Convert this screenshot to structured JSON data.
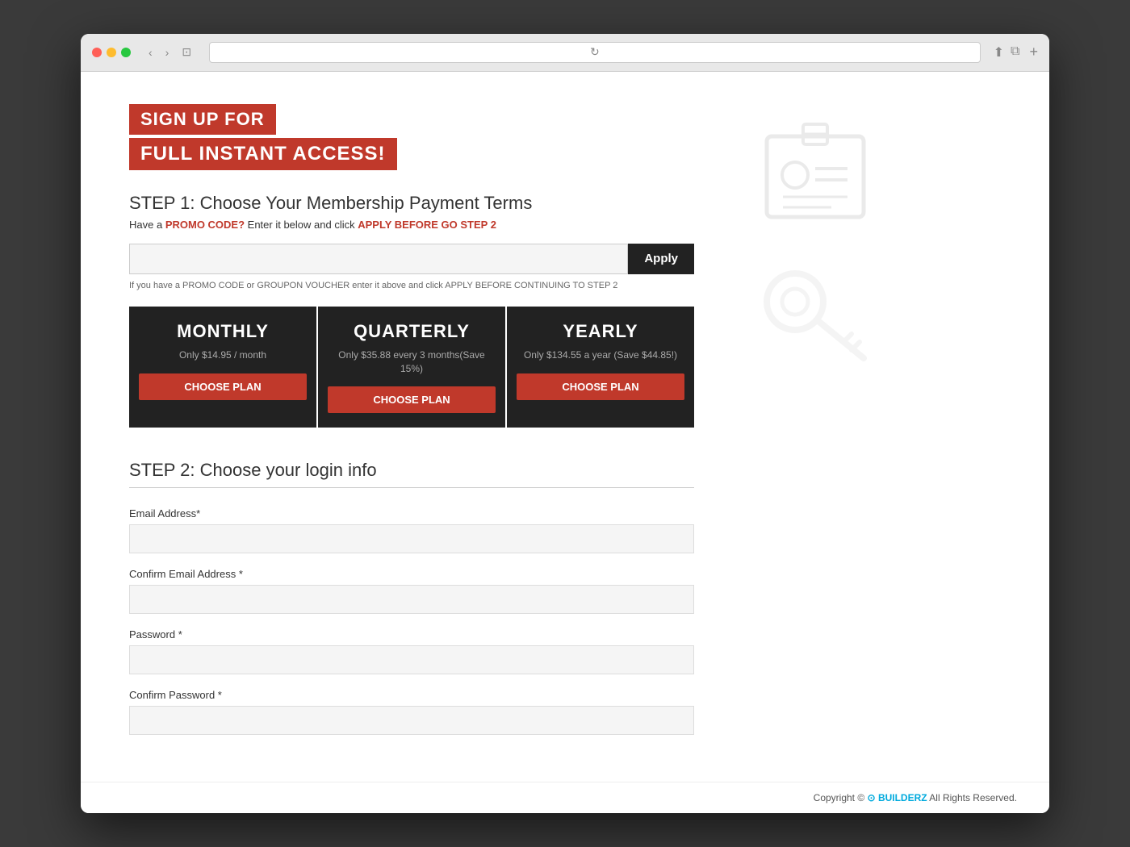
{
  "browser": {
    "tab_plus": "+",
    "refresh": "↻"
  },
  "header": {
    "line1": "SIGN UP FOR",
    "line2": "FULL INSTANT ACCESS!"
  },
  "step1": {
    "title": "STEP 1: Choose Your Membership Payment Terms",
    "promo_hint_pre": "Have a ",
    "promo_code_label": "PROMO CODE?",
    "promo_hint_mid": " Enter it below and click ",
    "apply_before_label": "APPLY BEFORE GO STEP 2",
    "promo_placeholder": "",
    "apply_button": "Apply",
    "promo_note": "If you have a PROMO CODE or GROUPON VOUCHER enter it above and click APPLY BEFORE CONTINUING TO STEP 2"
  },
  "plans": [
    {
      "name": "MONTHLY",
      "price": "Only $14.95 / month",
      "btn_label": "Choose Plan"
    },
    {
      "name": "QUARTERLY",
      "price": "Only $35.88 every 3 months(Save 15%)",
      "btn_label": "Choose Plan"
    },
    {
      "name": "YEARLY",
      "price": "Only $134.55 a year (Save $44.85!)",
      "btn_label": "Choose Plan"
    }
  ],
  "step2": {
    "title": "STEP 2: Choose your login info",
    "fields": [
      {
        "label": "Email Address*",
        "placeholder": ""
      },
      {
        "label": "Confirm Email Address *",
        "placeholder": ""
      },
      {
        "label": "Password *",
        "placeholder": ""
      },
      {
        "label": "Confirm Password *",
        "placeholder": ""
      }
    ]
  },
  "footer": {
    "copyright": "Copyright ©",
    "brand": "BUILDERZ",
    "rights": "All Rights Reserved."
  }
}
